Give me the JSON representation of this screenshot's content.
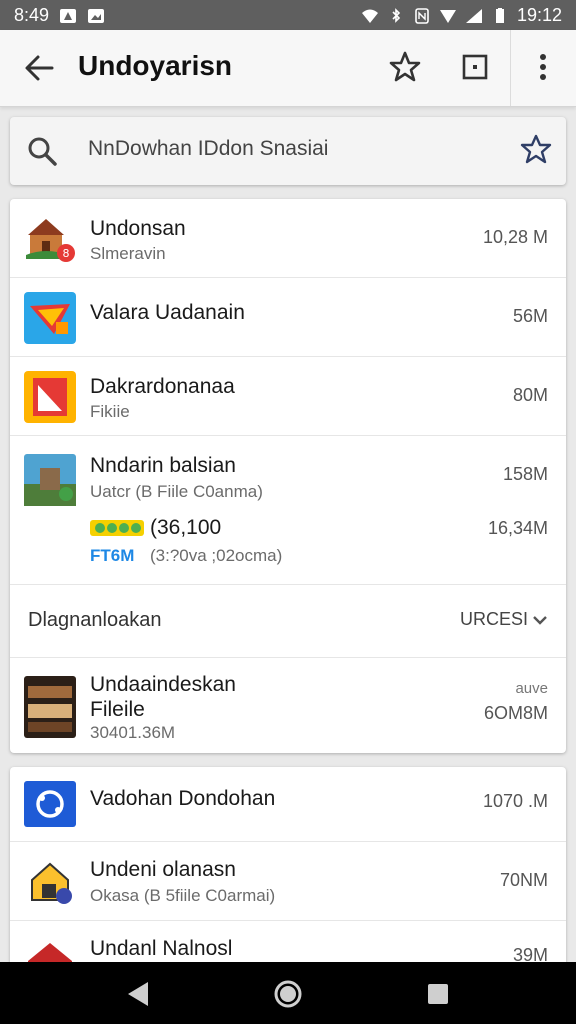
{
  "status_bar": {
    "time_left": "8:49",
    "time_right": "19:12"
  },
  "app_bar": {
    "title": "Undoyarisn"
  },
  "search": {
    "text": "NnDowhan IDdon Snasiai"
  },
  "apps": [
    {
      "name": "Undonsan",
      "sub": "Slmeravin",
      "size": "10,28 M"
    },
    {
      "name": "Valara Uadanain",
      "size": "56M"
    },
    {
      "name": "Dakrardonanaa",
      "sub": "Fikiie",
      "size": "80M"
    },
    {
      "name": "Nndarin balsian",
      "sub": "Uatcr (B Fiile C0anma)",
      "size": "158M",
      "extra_value": "(36,100",
      "extra_size": "16,34M",
      "extra_badge": "FT6M",
      "extra_sub": "(3:?0va ;02ocma)"
    }
  ],
  "section": {
    "label": "Dlagnanloakan",
    "sort_label": "URCESI"
  },
  "featured": {
    "name": "Undaaindeskan",
    "sub1": "Fileile",
    "sub2": "30401.36M",
    "size_top": "auve",
    "size": "6OM8M"
  },
  "apps2": [
    {
      "name": "Vadohan Dondohan",
      "size": "1070 .M"
    },
    {
      "name": "Undeni olanasn",
      "sub": "Okasa (B 5fiile C0armai)",
      "size": "70NM"
    },
    {
      "name": "Undanl Nalnosl",
      "size": "39M"
    }
  ],
  "colors": {
    "accent_blue": "#1e88e5",
    "status_bar": "#5f5f5f",
    "nav_bar": "#000000"
  },
  "icons": [
    "back-arrow-icon",
    "star-icon",
    "square-icon",
    "more-vert-icon",
    "search-icon",
    "triangle-back-icon",
    "circle-home-icon",
    "square-recents-icon"
  ]
}
